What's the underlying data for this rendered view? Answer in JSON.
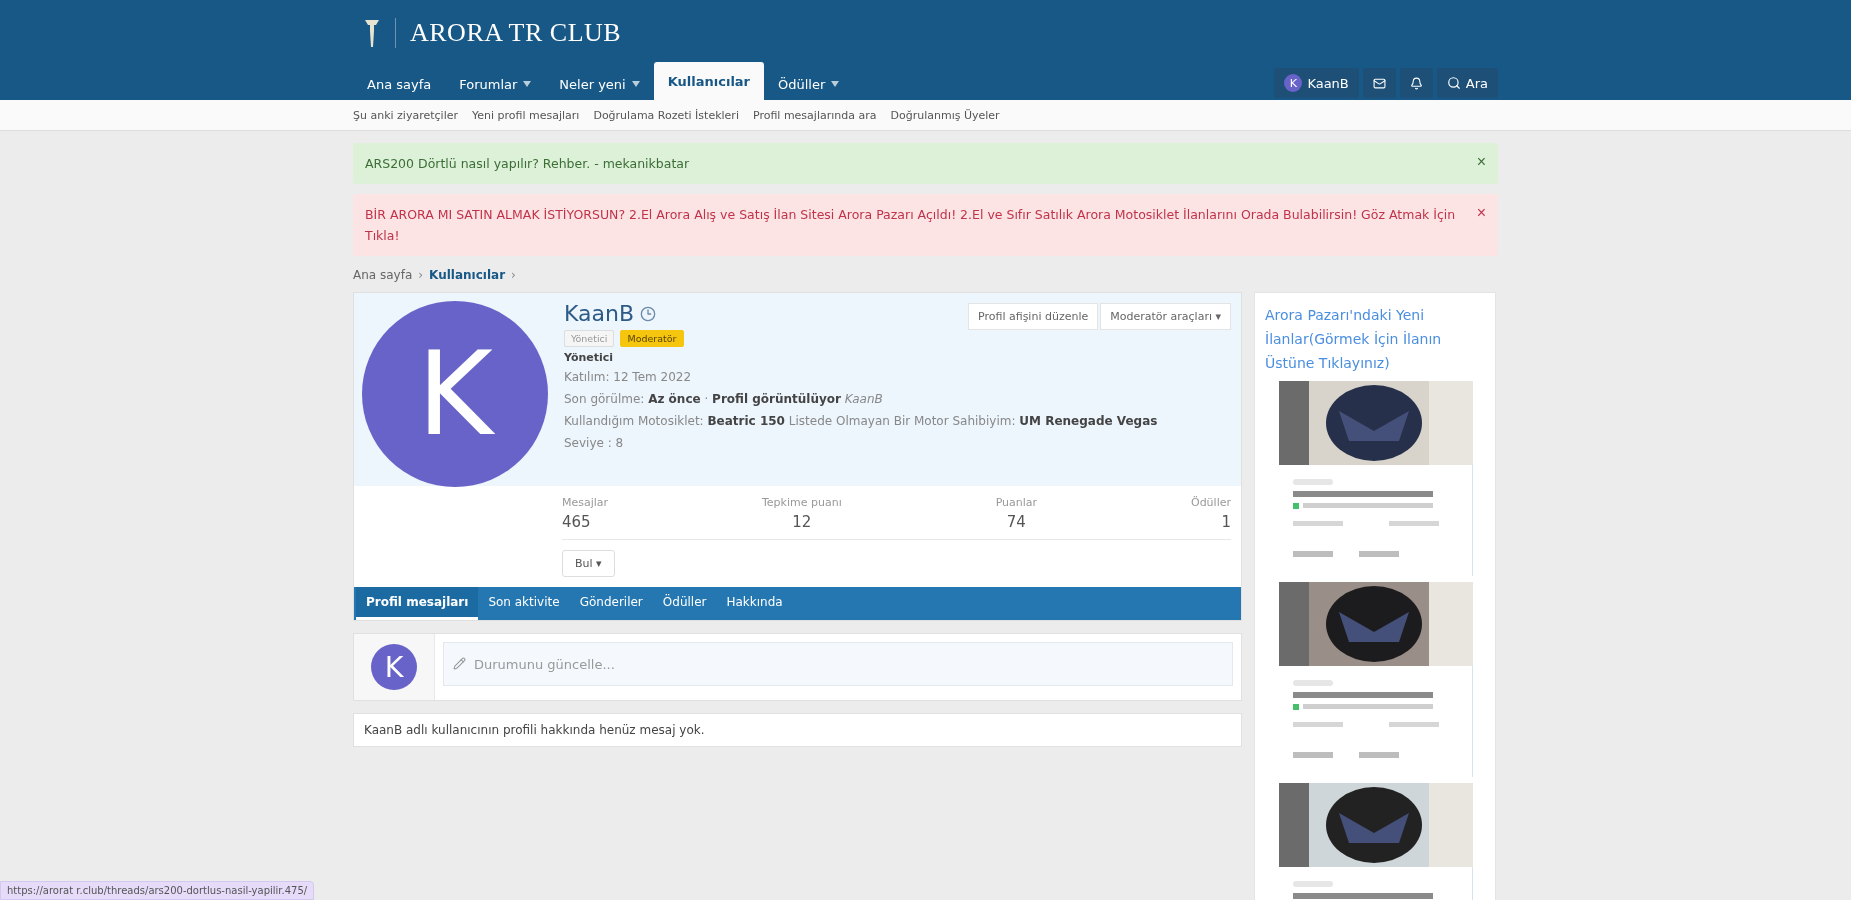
{
  "header": {
    "logo_text": "ARORA TR CLUB"
  },
  "nav": {
    "tabs": [
      {
        "label": "Ana sayfa",
        "selected": false,
        "has_menu": false
      },
      {
        "label": "Forumlar",
        "selected": false,
        "has_menu": true
      },
      {
        "label": "Neler yeni",
        "selected": false,
        "has_menu": true
      },
      {
        "label": "Kullanıcılar",
        "selected": true,
        "has_menu": false
      },
      {
        "label": "Ödüller",
        "selected": false,
        "has_menu": true
      }
    ],
    "user": {
      "initial": "K",
      "name": "KaanB"
    },
    "search_label": "Ara"
  },
  "subnav": [
    "Şu anki ziyaretçiler",
    "Yeni profil mesajları",
    "Doğrulama Rozeti İstekleri",
    "Profil mesajlarında ara",
    "Doğrulanmış Üyeler"
  ],
  "notices": [
    {
      "kind": "success",
      "text": "ARS200 Dörtlü nasıl yapılır? Rehber. - mekanikbatar",
      "close": "×"
    },
    {
      "kind": "error",
      "text": "BİR ARORA MI SATIN ALMAK İSTİYORSUN? 2.El Arora Alış ve Satış İlan Sitesi Arora Pazarı Açıldı! 2.El ve Sıfır Satılık Arora Motosiklet İlanlarını Orada Bulabilirsin! Göz Atmak İçin Tıkla!",
      "close": "×"
    }
  ],
  "breadcrumb": [
    {
      "label": "Ana sayfa",
      "separator": "›"
    },
    {
      "label": "Kullanıcılar",
      "separator": "›"
    }
  ],
  "profile": {
    "avatar_initial": "K",
    "name": "KaanB",
    "banners": [
      {
        "label": "Yönetici",
        "kind": "plain"
      },
      {
        "label": "Moderatör",
        "kind": "highlight"
      }
    ],
    "title": "Yönetici",
    "joined": "Katılım: 12 Tem 2022",
    "last_seen": "Son görülme: **Az önce** · **Profil görüntülüyor** *KaanB*",
    "motorcycle": "Kullandığım Motosiklet: **Beatric 150** Listede Olmayan Bir Motor Sahibiyim: **UM Renegade Vegas**",
    "level": "Seviye : 8",
    "actions": [
      "Profil afişini düzenle",
      "Moderatör araçları ▾"
    ],
    "stats": [
      {
        "label": "Mesajlar",
        "value": "465"
      },
      {
        "label": "Tepkime puanı",
        "value": "12"
      },
      {
        "label": "Puanlar",
        "value": "74"
      },
      {
        "label": "Ödüller",
        "value": "1"
      }
    ],
    "find_button": "Bul ▾",
    "tabs": [
      {
        "label": "Profil mesajları",
        "selected": true
      },
      {
        "label": "Son aktivite",
        "selected": false
      },
      {
        "label": "Gönderiler",
        "selected": false
      },
      {
        "label": "Ödüller",
        "selected": false
      },
      {
        "label": "Hakkında",
        "selected": false
      }
    ],
    "composer": {
      "avatar_initial": "K",
      "placeholder": "Durumunu güncelle..."
    },
    "empty_message": "KaanB adlı kullanıcının profili hakkında henüz mesaj yok."
  },
  "sidebar": {
    "title": "Arora Pazarı'ndaki Yeni İlanlar(Görmek İçin İlanın Üstüne Tıklayınız)"
  },
  "status_bar": {
    "url": "https://arorat r.club/threads/ars200-dortlus-nasil-yapilir.475/"
  }
}
